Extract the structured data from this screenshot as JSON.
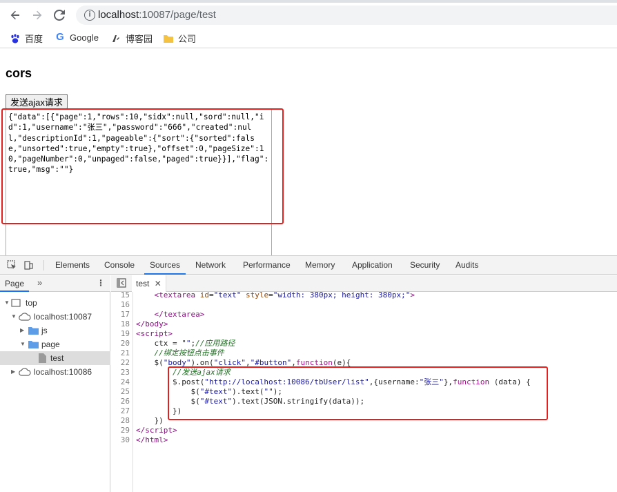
{
  "browser": {
    "url_host": "localhost",
    "url_rest": ":10087/page/test",
    "bookmarks": [
      "百度",
      "Google",
      "博客园",
      "公司"
    ]
  },
  "page": {
    "title": "cors",
    "button_label": "发送ajax请求",
    "textarea_value": "{\"data\":[{\"page\":1,\"rows\":10,\"sidx\":null,\"sord\":null,\"id\":1,\"username\":\"张三\",\"password\":\"666\",\"created\":null,\"descriptionId\":1,\"pageable\":{\"sort\":{\"sorted\":false,\"unsorted\":true,\"empty\":true},\"offset\":0,\"pageSize\":10,\"pageNumber\":0,\"unpaged\":false,\"paged\":true}}],\"flag\":true,\"msg\":\"\"}"
  },
  "devtools": {
    "tabs": [
      "Elements",
      "Console",
      "Sources",
      "Network",
      "Performance",
      "Memory",
      "Application",
      "Security",
      "Audits"
    ],
    "active_tab": "Sources",
    "sidebar_tab": "Page",
    "more_tabs": "»",
    "tree": [
      {
        "label": "top",
        "type": "frame"
      },
      {
        "label": "localhost:10087",
        "type": "cloud"
      },
      {
        "label": "js",
        "type": "folder"
      },
      {
        "label": "page",
        "type": "folder"
      },
      {
        "label": "test",
        "type": "file"
      },
      {
        "label": "localhost:10086",
        "type": "cloud"
      }
    ],
    "open_file": "test",
    "line_numbers": [
      "15",
      "16",
      "17",
      "18",
      "19",
      "20",
      "21",
      "22",
      "23",
      "24",
      "25",
      "26",
      "27",
      "28",
      "29",
      "30"
    ]
  }
}
